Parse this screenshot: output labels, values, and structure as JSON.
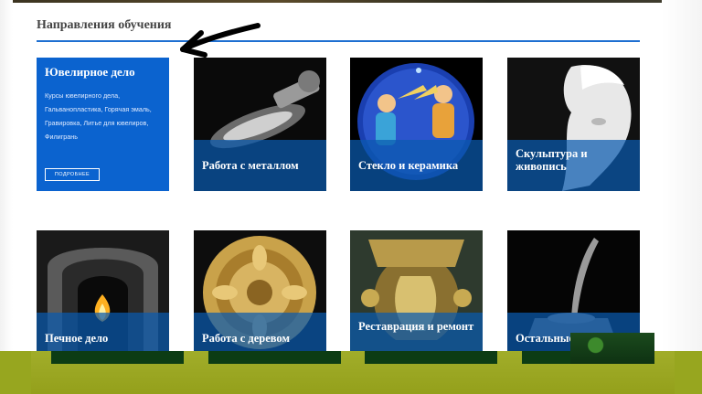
{
  "section": {
    "title": "Направления обучения"
  },
  "featured": {
    "title": "Ювелирное дело",
    "description": "Курсы ювелирного дела, Гальванопластика, Горячая эмаль, Гравировка, Литье для ювелиров, Филигрань",
    "button_label": "ПОДРОБНЕЕ"
  },
  "tiles": [
    {
      "label": "Работа с металлом"
    },
    {
      "label": "Стекло и керамика"
    },
    {
      "label": "Скульптура и живопись"
    },
    {
      "label": "Печное дело"
    },
    {
      "label": "Работа с деревом"
    },
    {
      "label": "Реставрация и ремонт"
    },
    {
      "label": "Остальные курсы"
    }
  ],
  "colors": {
    "accent": "#1e6fd1",
    "caption_overlay": "#0a5aaf",
    "footer": "#97a61f"
  }
}
